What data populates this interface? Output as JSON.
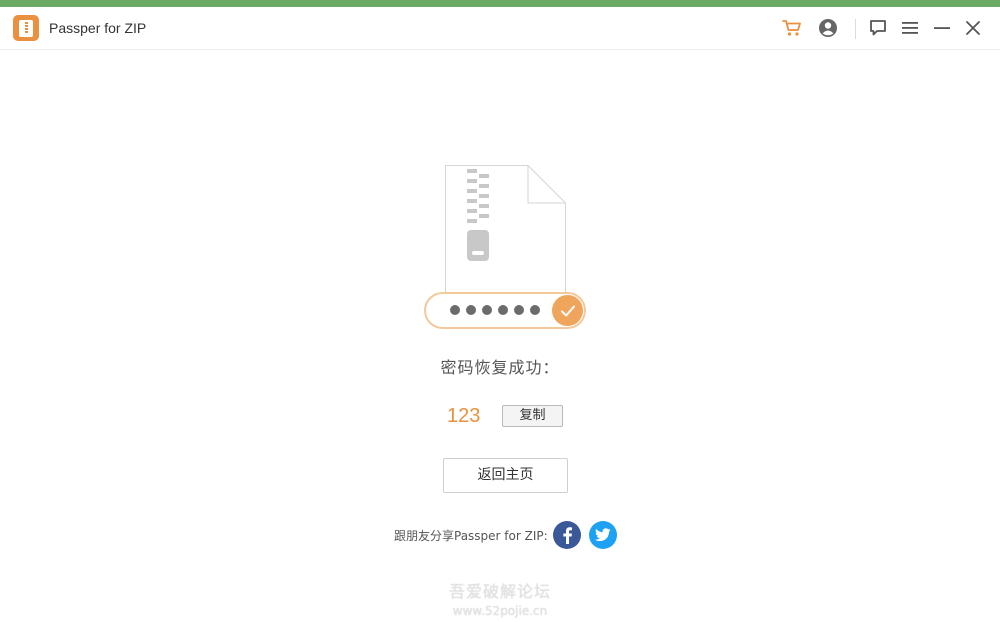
{
  "app": {
    "title": "Passper for ZIP",
    "logo_icon": "zip-logo-icon"
  },
  "titlebar": {
    "icons": [
      "cart-icon",
      "account-icon",
      "feedback-icon",
      "menu-icon",
      "minimize-icon",
      "close-icon"
    ]
  },
  "result": {
    "success_text": "密码恢复成功：",
    "password": "123",
    "copy_label": "复制",
    "masked_length": 6
  },
  "actions": {
    "home_label": "返回主页"
  },
  "share": {
    "label": "跟朋友分享Passper for ZIP:",
    "networks": [
      "facebook-icon",
      "twitter-icon"
    ]
  },
  "watermark": {
    "line1": "吾爱破解论坛",
    "line2": "www.52pojie.cn"
  },
  "colors": {
    "accent": "#e9913f",
    "check": "#f0a55c",
    "top_bar": "#6aaa64",
    "facebook": "#3b5998",
    "twitter": "#1da1f2"
  }
}
